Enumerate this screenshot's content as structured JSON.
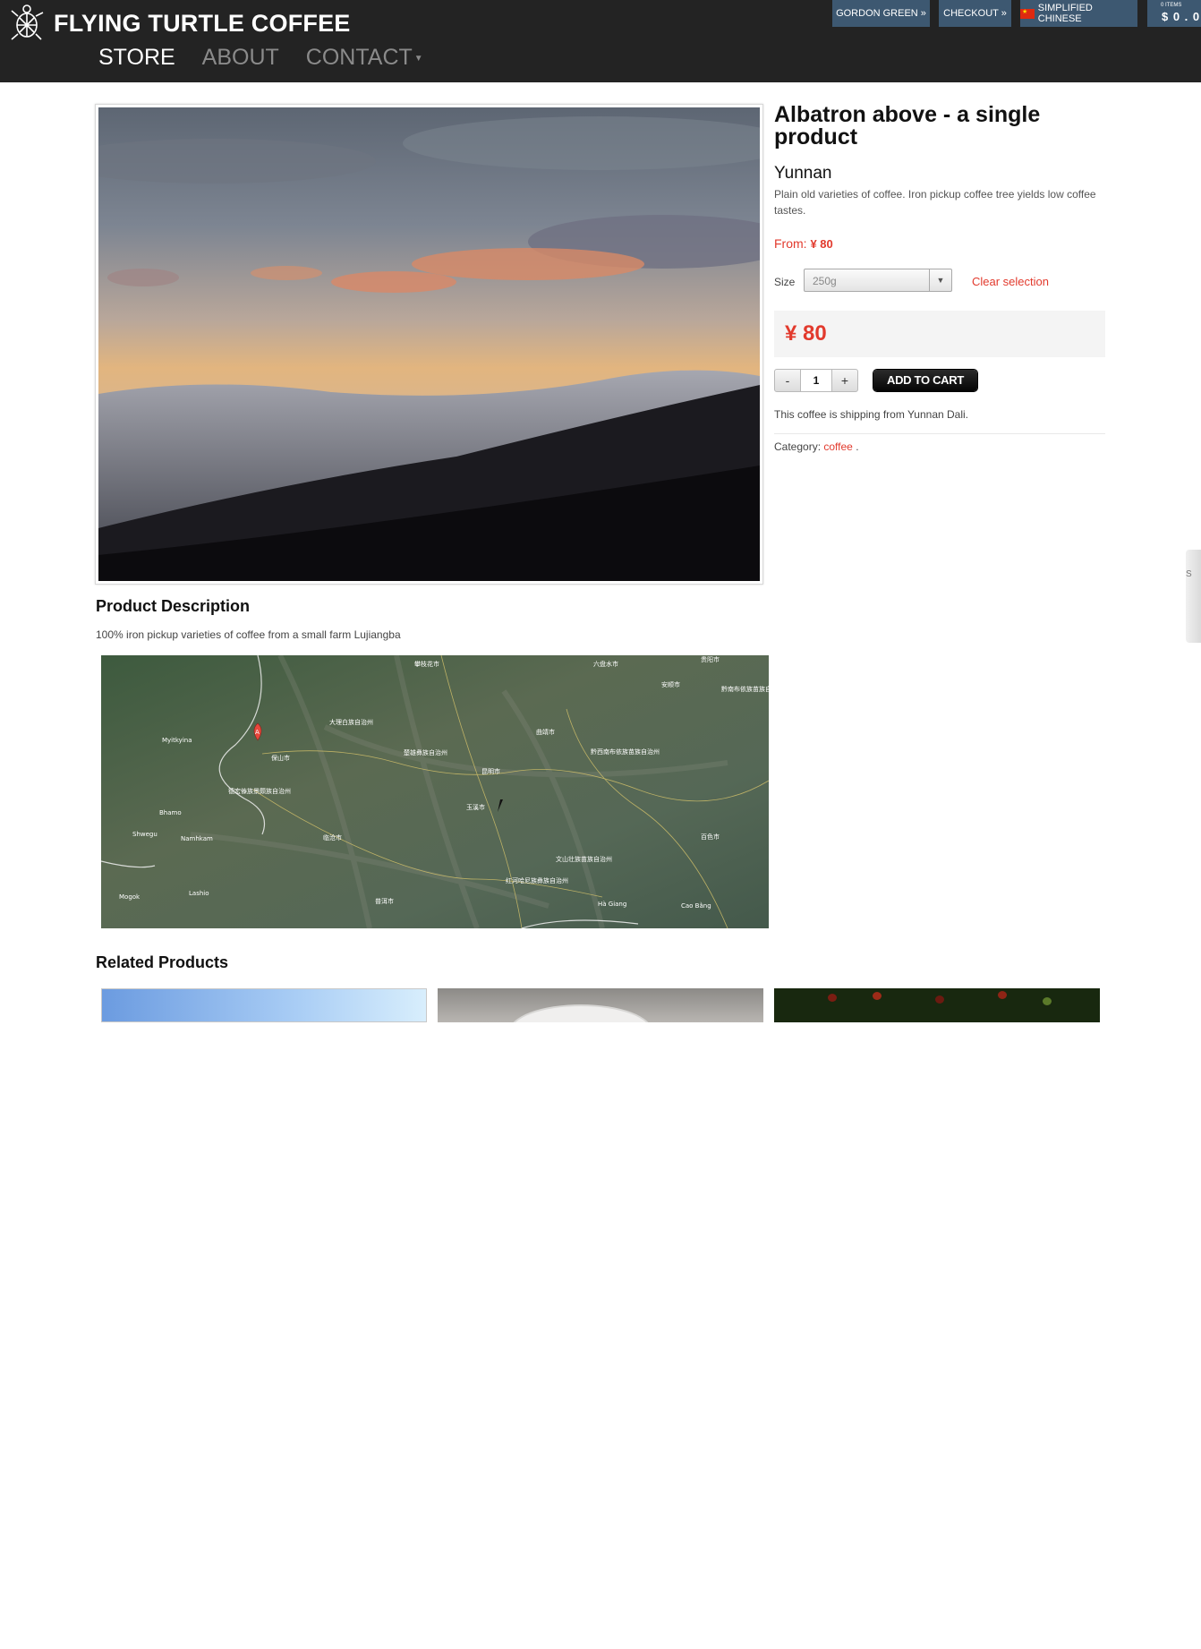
{
  "brand": {
    "name": "FLYING TURTLE COFFEE"
  },
  "nav": {
    "store": "STORE",
    "about": "ABOUT",
    "contact": "CONTACT"
  },
  "topbar": {
    "account": "GORDON GREEN »",
    "checkout": "CHECKOUT »",
    "language": "SIMPLIFIED CHINESE",
    "cart_items": "0 ITEMS",
    "cart_total": "$ 0 . 0"
  },
  "product": {
    "title": "Albatron above - a single product",
    "origin": "Yunnan",
    "short_description": "Plain old varieties of coffee. Iron pickup coffee tree yields low coffee tastes.",
    "from_label": "From:",
    "from_price": "¥ 80",
    "size_label": "Size",
    "size_value": "250g",
    "clear_selection": "Clear selection",
    "price": "¥ 80",
    "qty_minus": "-",
    "quantity": "1",
    "qty_plus": "+",
    "add_to_cart": "ADD TO CART",
    "shipping_note": "This coffee is shipping from Yunnan Dali.",
    "category_label": "Category:",
    "category": "coffee",
    "category_suffix": "."
  },
  "description": {
    "heading": "Product Description",
    "text": "100% iron pickup varieties of coffee from a small farm Lujiangba"
  },
  "map_labels": {
    "myitkyina": "Myitkyina",
    "bhamo": "Bhamo",
    "shwegu": "Shwegu",
    "namhkam": "Namhkam",
    "mogok": "Mogok",
    "lashio": "Lashio",
    "dali": "大理白族自治州",
    "kunming": "昆明市",
    "yuxi": "玉溪市",
    "baoshan": "保山市",
    "lincang": "临沧市",
    "puer": "普洱市",
    "qujing": "曲靖市",
    "chuxiong": "楚雄彝族自治州",
    "dehong": "德宏傣族景颇族自治州",
    "wenshan": "文山壮族苗族自治州",
    "honghe": "红河哈尼族彝族自治州",
    "guiyang": "贵阳市",
    "anshun": "安顺市",
    "liupanshui": "六盘水市",
    "panzhihua": "攀枝花市",
    "qiannan": "黔南布依族苗族自治州",
    "qianxinan": "黔西南布依族苗族自治州",
    "baise": "百色市",
    "hagiang": "Hà Giang",
    "caobang": "Cao Bằng",
    "marker": "A"
  },
  "related": {
    "heading": "Related Products"
  },
  "side_tab": {
    "label": "S"
  }
}
